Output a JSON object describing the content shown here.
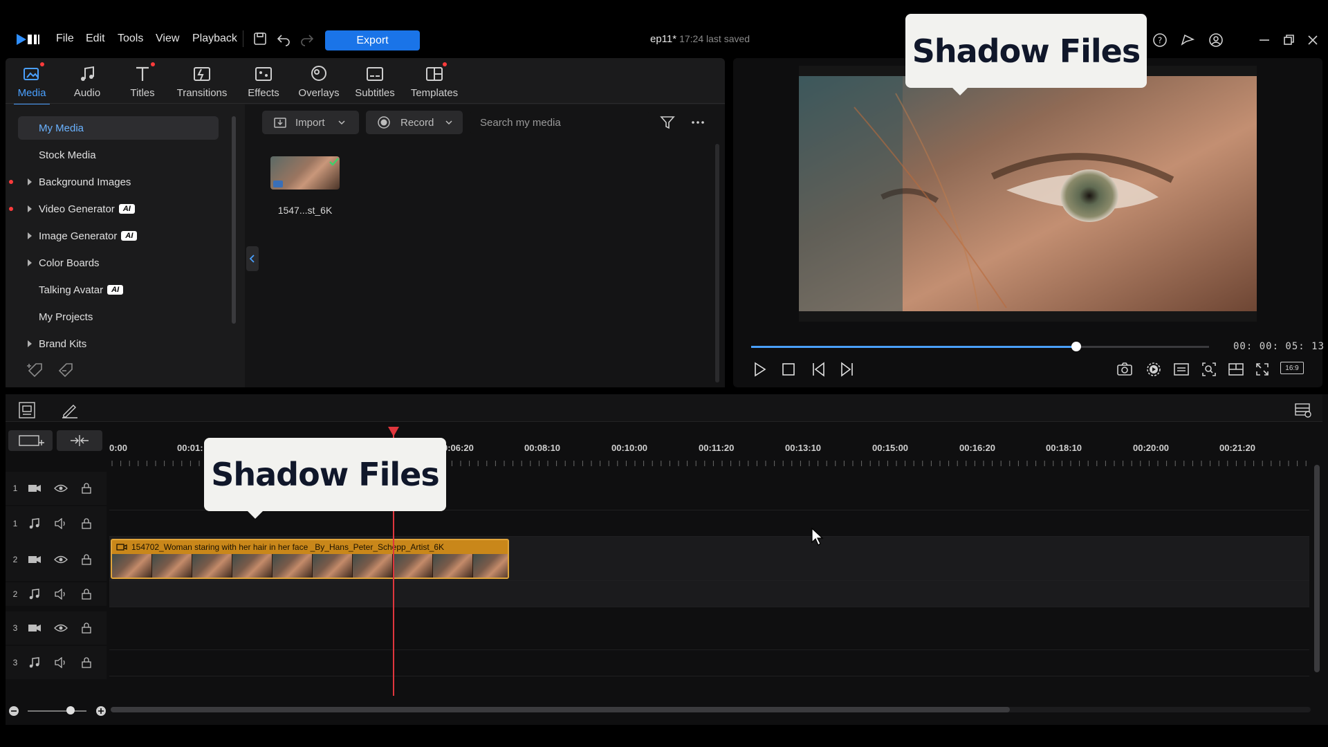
{
  "menu": {
    "items": [
      "File",
      "Edit",
      "Tools",
      "View",
      "Playback"
    ],
    "export_label": "Export"
  },
  "document": {
    "title": "ep11*",
    "saved": "17:24 last saved"
  },
  "tabs": [
    {
      "label": "Media",
      "icon": "media-icon",
      "active": true,
      "dot": true
    },
    {
      "label": "Audio",
      "icon": "music-note-icon",
      "active": false,
      "dot": false
    },
    {
      "label": "Titles",
      "icon": "text-t-icon",
      "active": false,
      "dot": true
    },
    {
      "label": "Transitions",
      "icon": "transition-icon",
      "active": false,
      "dot": false
    },
    {
      "label": "Effects",
      "icon": "effects-icon",
      "active": false,
      "dot": false
    },
    {
      "label": "Overlays",
      "icon": "overlays-icon",
      "active": false,
      "dot": false
    },
    {
      "label": "Subtitles",
      "icon": "subtitles-icon",
      "active": false,
      "dot": false
    },
    {
      "label": "Templates",
      "icon": "templates-icon",
      "active": false,
      "dot": true
    }
  ],
  "sidebar": {
    "items": [
      {
        "label": "My Media",
        "active": true,
        "expandable": false,
        "ai": false,
        "dot": false
      },
      {
        "label": "Stock Media",
        "active": false,
        "expandable": false,
        "ai": false,
        "dot": false
      },
      {
        "label": "Background Images",
        "active": false,
        "expandable": true,
        "ai": false,
        "dot": true
      },
      {
        "label": "Video Generator",
        "active": false,
        "expandable": true,
        "ai": true,
        "dot": true
      },
      {
        "label": "Image Generator",
        "active": false,
        "expandable": true,
        "ai": true,
        "dot": false
      },
      {
        "label": "Color Boards",
        "active": false,
        "expandable": true,
        "ai": false,
        "dot": false
      },
      {
        "label": "Talking Avatar",
        "active": false,
        "expandable": false,
        "ai": true,
        "dot": false
      },
      {
        "label": "My Projects",
        "active": false,
        "expandable": false,
        "ai": false,
        "dot": false
      },
      {
        "label": "Brand Kits",
        "active": false,
        "expandable": true,
        "ai": false,
        "dot": false
      }
    ],
    "ai_badge": "AI"
  },
  "media_toolbar": {
    "import_label": "Import",
    "record_label": "Record",
    "search_placeholder": "Search my media"
  },
  "media_items": [
    {
      "name": "1547...st_6K"
    }
  ],
  "watermark": {
    "text": "Shadow Files"
  },
  "preview": {
    "timecode": "00: 00: 05: 13",
    "progress": 0.71,
    "aspect_label": "16:9"
  },
  "timeline": {
    "ruler": [
      "0:00",
      "00:01:",
      "0:06:20",
      "00:08:10",
      "00:10:00",
      "00:11:20",
      "00:13:10",
      "00:15:00",
      "00:16:20",
      "00:18:10",
      "00:20:00",
      "00:21:20"
    ],
    "tracks": [
      {
        "num": "1",
        "kind": "video"
      },
      {
        "num": "1",
        "kind": "audio"
      },
      {
        "num": "2",
        "kind": "video"
      },
      {
        "num": "2",
        "kind": "audio"
      },
      {
        "num": "3",
        "kind": "video"
      },
      {
        "num": "3",
        "kind": "audio"
      }
    ],
    "clip_label": "154702_Woman staring with her hair in her face _By_Hans_Peter_Schepp_Artist_6K"
  },
  "colors": {
    "accent": "#1a74e8",
    "active_tab": "#4aa0ff",
    "clip": "#c9871a",
    "playhead": "#e0363d"
  }
}
